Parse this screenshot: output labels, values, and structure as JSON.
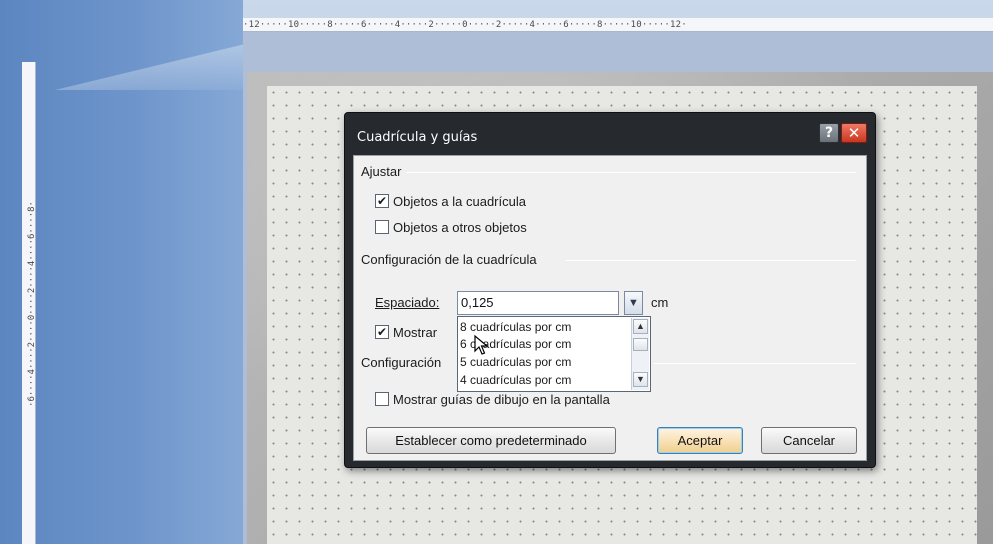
{
  "window": {
    "ruler_top_text": "·12·····10·····8·····6·····4·····2·····0·····2·····4·····6·····8·····10·····12·",
    "ruler_left_text": "·6····4····2····0····2····4····6····8·"
  },
  "dialog": {
    "title": "Cuadrícula y guías",
    "help_glyph": "?",
    "close_glyph": "✕",
    "groups": {
      "ajustar": "Ajustar",
      "grid_config": "Configuración de la cuadrícula",
      "guides_config": "Configuración"
    },
    "checkboxes": {
      "snap_grid": {
        "label": "Objetos a la cuadrícula",
        "checked": true
      },
      "snap_objects": {
        "label": "Objetos a otros objetos",
        "checked": false
      },
      "show_grid": {
        "label": "Mostrar",
        "checked": true
      },
      "show_guides": {
        "label": "Mostrar guías de dibujo en la pantalla",
        "checked": false
      }
    },
    "spacing": {
      "label": "Espaciado:",
      "value": "0,125",
      "unit": "cm"
    },
    "dropdown_options": [
      "8 cuadrículas por  cm",
      "6 cuadrículas por  cm",
      "5 cuadrículas por  cm",
      "4 cuadrículas por  cm"
    ],
    "buttons": {
      "set_default": "Establecer como predeterminado",
      "ok": "Aceptar",
      "cancel": "Cancelar"
    }
  },
  "glyphs": {
    "check": "✔",
    "drop_arrow": "▼",
    "scroll_up": "▲",
    "scroll_down": "▼"
  },
  "colors": {
    "title_bar": "#26292e",
    "close_button": "#c8371f",
    "ok_button": "#f0cf8d",
    "thumbnail_pane": "#6e95cb"
  },
  "icons": [
    "help-icon",
    "close-icon",
    "check-icon",
    "dropdown-arrow-icon",
    "cursor-icon"
  ]
}
